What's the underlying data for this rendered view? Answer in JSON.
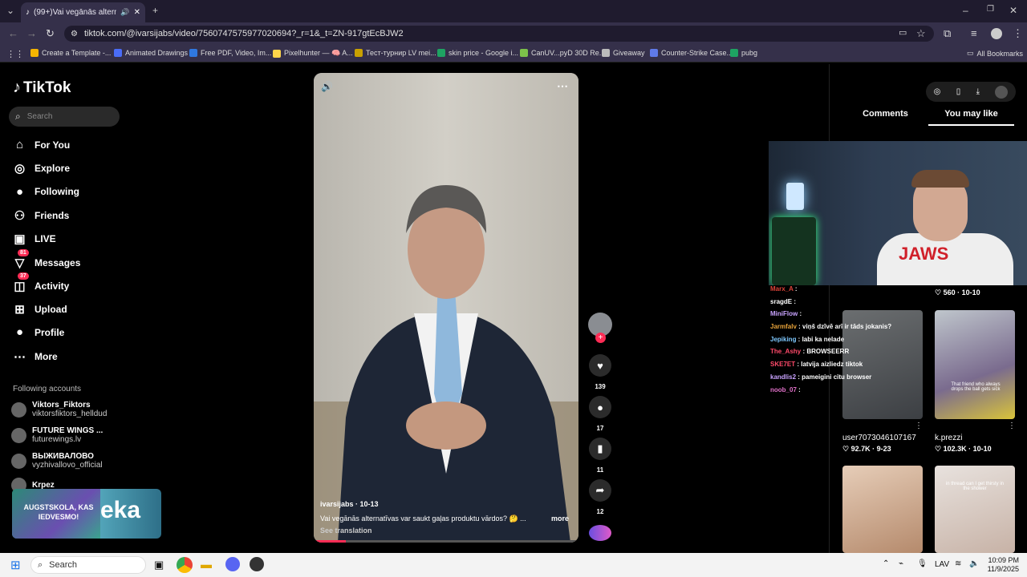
{
  "browser": {
    "tab_title": "(99+)Vai vegānās alternatīv",
    "url": "tiktok.com/@ivarsijabs/video/7560747575977020694?_r=1&_t=ZN-917gtEcBJW2",
    "bookmarks": [
      {
        "label": "Create a Template -...",
        "color": "#f5b400"
      },
      {
        "label": "Animated Drawings",
        "color": "#4a6cf7"
      },
      {
        "label": "Free PDF, Video, Im...",
        "color": "#2f78e0"
      },
      {
        "label": "Pixelhunter — 🧠 A...",
        "color": "#ffd54a"
      },
      {
        "label": "Тест-турнир LV mei...",
        "color": "#c9a100"
      },
      {
        "label": "skin price - Google i...",
        "color": "#1ea362"
      },
      {
        "label": "CanUV...pyD 30D Re...",
        "color": "#7cc14a"
      },
      {
        "label": "Giveaway",
        "color": "#bbbbbb"
      },
      {
        "label": "Counter-Strike Case...",
        "color": "#5f7ae8"
      },
      {
        "label": "pubg",
        "color": "#1ea362"
      }
    ],
    "all_bookmarks": "All Bookmarks"
  },
  "sidebar": {
    "logo": "TikTok",
    "search_placeholder": "Search",
    "nav": [
      {
        "label": "For You",
        "icon": "home-icon"
      },
      {
        "label": "Explore",
        "icon": "compass-icon"
      },
      {
        "label": "Following",
        "icon": "following-icon"
      },
      {
        "label": "Friends",
        "icon": "friends-icon"
      },
      {
        "label": "LIVE",
        "icon": "live-icon"
      },
      {
        "label": "Messages",
        "icon": "messages-icon",
        "badge": "81"
      },
      {
        "label": "Activity",
        "icon": "activity-icon",
        "badge": "37"
      },
      {
        "label": "Upload",
        "icon": "upload-icon"
      },
      {
        "label": "Profile",
        "icon": "profile-icon"
      },
      {
        "label": "More",
        "icon": "more-icon"
      }
    ],
    "following_title": "Following accounts",
    "accounts": [
      {
        "name": "Viktors_Fiktors",
        "handle": "viktorsfiktors_helldud"
      },
      {
        "name": "FUTURE WINGS ...",
        "handle": "futurewings.lv"
      },
      {
        "name": "ВЫЖИВАЛОВО",
        "handle": "vyzhivallovo_official"
      },
      {
        "name": "Krpez",
        "handle": ""
      }
    ],
    "promo_text": "AUGSTSKOLA, KAS IEDVESMO!",
    "promo_logo": "eka"
  },
  "video": {
    "author": "ivarsijabs · 10-13",
    "caption": "Vai vegānās alternatīvas var saukt gaļas produktu vārdos? 🤔 ...",
    "more": "more",
    "see_translation": "See translation",
    "progress": 0.12
  },
  "actions": {
    "likes": "139",
    "comments": "17",
    "saves": "11",
    "shares": "12"
  },
  "right": {
    "tab_comments": "Comments",
    "tab_you_may_like": "You may like",
    "cards": [
      {
        "stats": "♡ 560 · 10-10",
        "user": "",
        "thumb": "#5a6470"
      },
      {
        "stats": "♡ 92.7K · 9-23",
        "user": "user7073046107167",
        "thumb": "#4b4f55"
      },
      {
        "stats": "♡ 102.3K · 10-10",
        "user": "k.prezzi",
        "thumb": "#9aa3a8",
        "caption": "That friend who always drops the ball gets sick"
      },
      {
        "stats": "",
        "user": "",
        "thumb": "#c9a48a"
      },
      {
        "stats": "",
        "user": "",
        "thumb": "#d9cfc8",
        "caption": "in thread can I get thirsty in the shower"
      }
    ]
  },
  "stream": {
    "shirt_text": "JAWS",
    "chat": [
      {
        "user": "Marx_A",
        "msg": "",
        "color": "#e0443a"
      },
      {
        "user": "sragdE",
        "msg": "",
        "color": "#ffffff"
      },
      {
        "user": "MiniFlow",
        "msg": "",
        "color": "#c9a3ff"
      },
      {
        "user": "Jarmfalv",
        "msg": "viņš dzīvē arī ir tāds jokanis?",
        "color": "#e8a33a"
      },
      {
        "user": "Jepiking",
        "msg": "labi ka nelade",
        "color": "#7ec8ff"
      },
      {
        "user": "The_Ashy",
        "msg": "BROWSEERR",
        "color": "#ff4a6a"
      },
      {
        "user": "SKE7ET",
        "msg": "latvija aizliedz tiktok",
        "color": "#ff4a6a"
      },
      {
        "user": "kandlis2",
        "msg": "pameigini citu browser",
        "color": "#c9a3ff"
      },
      {
        "user": "noob_07",
        "msg": "",
        "color": "#e070c8"
      }
    ]
  },
  "taskbar": {
    "search": "Search",
    "lang": "LAV",
    "time": "10:09 PM",
    "date": "11/9/2025"
  }
}
